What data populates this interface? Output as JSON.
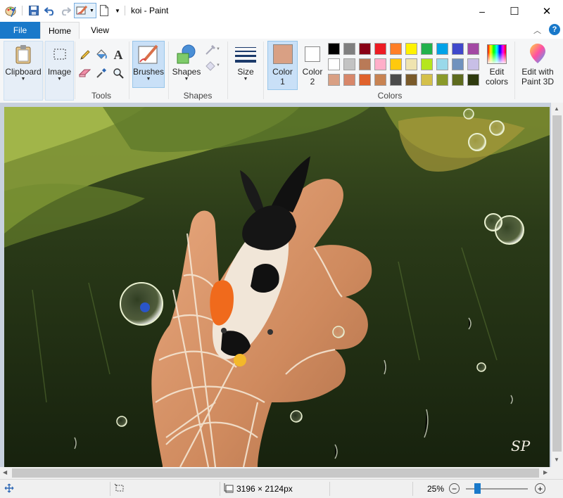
{
  "window": {
    "title": "koi - Paint",
    "controls": {
      "minimize": "–",
      "maximize": "☐",
      "close": "✕"
    }
  },
  "ribbon_tabs": [
    "File",
    "Home",
    "View"
  ],
  "help_glyph": "?",
  "groups": {
    "clipboard": {
      "label": "Clipboard"
    },
    "image": {
      "label": "Image"
    },
    "tools": {
      "label": "Tools"
    },
    "brushes": {
      "label": "Brushes"
    },
    "shapes": {
      "label": "Shapes",
      "button": "Shapes"
    },
    "size": {
      "label": "Size"
    },
    "color1": {
      "label": "Color",
      "sub": "1"
    },
    "color2": {
      "label": "Color",
      "sub": "2"
    },
    "colors": {
      "label": "Colors"
    },
    "edit_colors": {
      "line1": "Edit",
      "line2": "colors"
    },
    "paint3d": {
      "line1": "Edit with",
      "line2": "Paint 3D"
    }
  },
  "active_colors": {
    "color1": "#d9a084",
    "color2": "#ffffff"
  },
  "palette": {
    "row1": [
      "#000000",
      "#7f7f7f",
      "#880015",
      "#ed1c24",
      "#ff7f27",
      "#fff200",
      "#22b14c",
      "#00a2e8",
      "#3f48cc",
      "#a349a4"
    ],
    "row2": [
      "#ffffff",
      "#c3c3c3",
      "#b97a57",
      "#ffaec9",
      "#ffc90e",
      "#efe4b0",
      "#b5e61d",
      "#99d9ea",
      "#7092be",
      "#c8bfe7"
    ],
    "row3": [
      "#d9a084",
      "#d8876a",
      "#e0622c",
      "#c88352",
      "#4b4b4b",
      "#7a5a2a",
      "#d4c04a",
      "#8a9a2a",
      "#5e6b1e",
      "#2e3a0e"
    ]
  },
  "status": {
    "dimensions": "3196 × 2124px",
    "zoom": "25%",
    "zoom_level": 0.25
  },
  "artwork": {
    "signature": "SP"
  }
}
